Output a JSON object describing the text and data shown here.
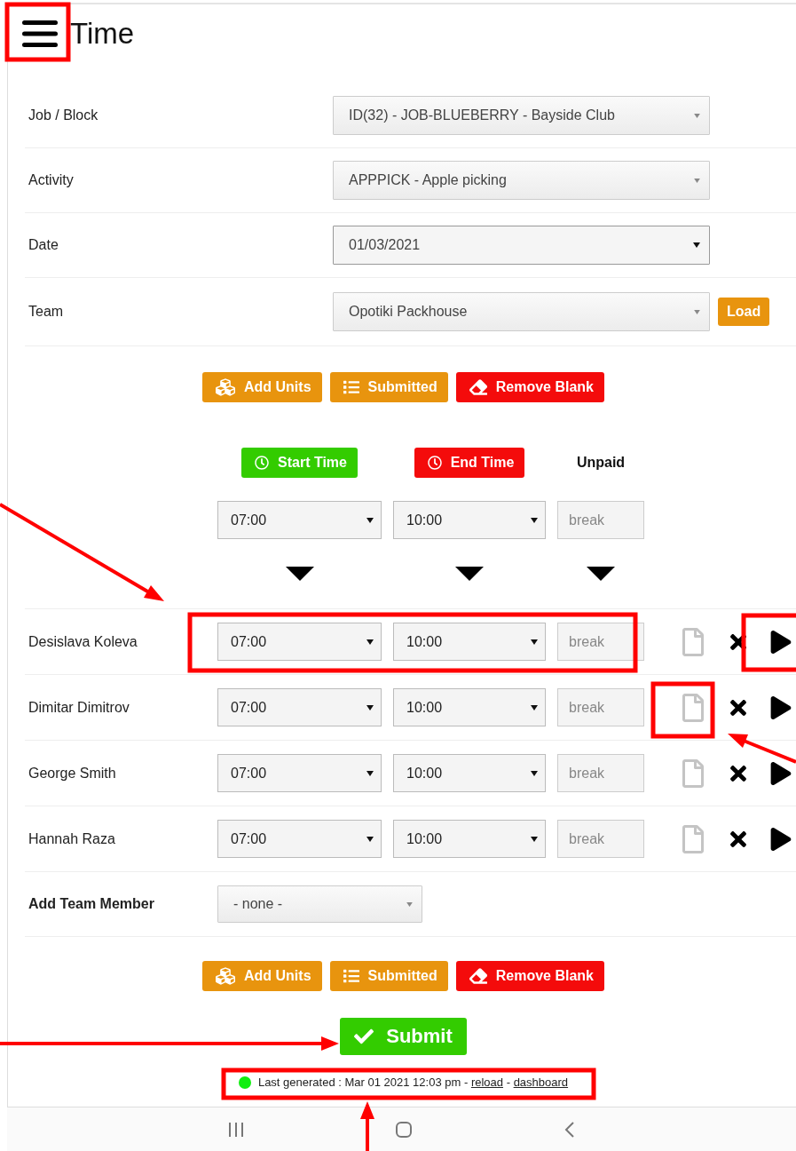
{
  "header": {
    "title": "Time"
  },
  "fields": [
    {
      "label": "Job / Block",
      "value": "ID(32) - JOB-BLUEBERRY - Bayside Club",
      "kind": "select"
    },
    {
      "label": "Activity",
      "value": "APPPICK - Apple picking",
      "kind": "select"
    },
    {
      "label": "Date",
      "value": "01/03/2021",
      "kind": "native"
    },
    {
      "label": "Team",
      "value": "Opotiki Packhouse",
      "kind": "select",
      "action": "Load"
    }
  ],
  "toolbar_top": [
    {
      "label": "Add Units",
      "kind": "units"
    },
    {
      "label": "Submitted",
      "kind": "list"
    },
    {
      "label": "Remove Blank",
      "kind": "eraser"
    }
  ],
  "time_header": {
    "start": "Start Time",
    "end": "End Time",
    "unpaid": "Unpaid"
  },
  "defaults": {
    "start": "07:00",
    "end": "10:00",
    "placeholder": "break"
  },
  "members": [
    {
      "name": "Desislava Koleva",
      "start": "07:00",
      "end": "10:00",
      "placeholder": "break"
    },
    {
      "name": "Dimitar Dimitrov",
      "start": "07:00",
      "end": "10:00",
      "placeholder": "break"
    },
    {
      "name": "George Smith",
      "start": "07:00",
      "end": "10:00",
      "placeholder": "break"
    },
    {
      "name": "Hannah Raza",
      "start": "07:00",
      "end": "10:00",
      "placeholder": "break"
    }
  ],
  "add_member": {
    "label": "Add Team Member",
    "value": "- none -"
  },
  "toolbar_bottom": [
    {
      "label": "Add Units",
      "kind": "units"
    },
    {
      "label": "Submitted",
      "kind": "list"
    },
    {
      "label": "Remove Blank",
      "kind": "eraser"
    }
  ],
  "submit": "Submit",
  "footer": {
    "online": true,
    "text": "Last generated : Mar 01 2021 12:03 pm",
    "separator": "-",
    "links": [
      "reload",
      "dashboard"
    ]
  }
}
